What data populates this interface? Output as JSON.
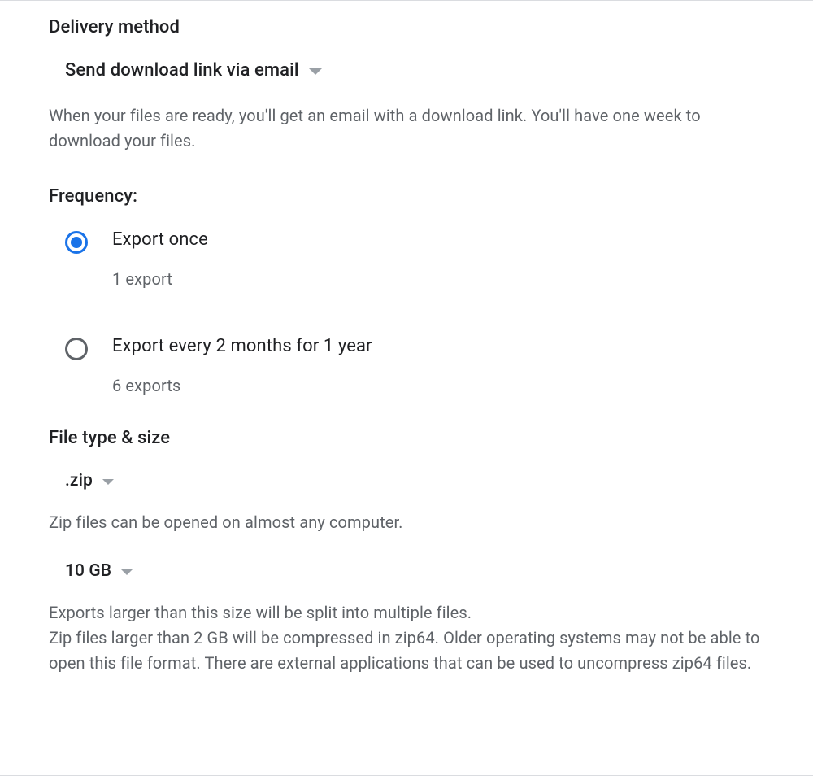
{
  "delivery": {
    "heading": "Delivery method",
    "selected": "Send download link via email",
    "description": "When your files are ready, you'll get an email with a download link. You'll have one week to download your files."
  },
  "frequency": {
    "heading": "Frequency:",
    "options": [
      {
        "label": "Export once",
        "sub": "1 export",
        "selected": true
      },
      {
        "label": "Export every 2 months for 1 year",
        "sub": "6 exports",
        "selected": false
      }
    ]
  },
  "filetype": {
    "heading": "File type & size",
    "type_selected": ".zip",
    "type_description": "Zip files can be opened on almost any computer.",
    "size_selected": "10 GB",
    "size_description": "Exports larger than this size will be split into multiple files.\nZip files larger than 2 GB will be compressed in zip64. Older operating systems may not be able to open this file format. There are external applications that can be used to uncompress zip64 files."
  }
}
